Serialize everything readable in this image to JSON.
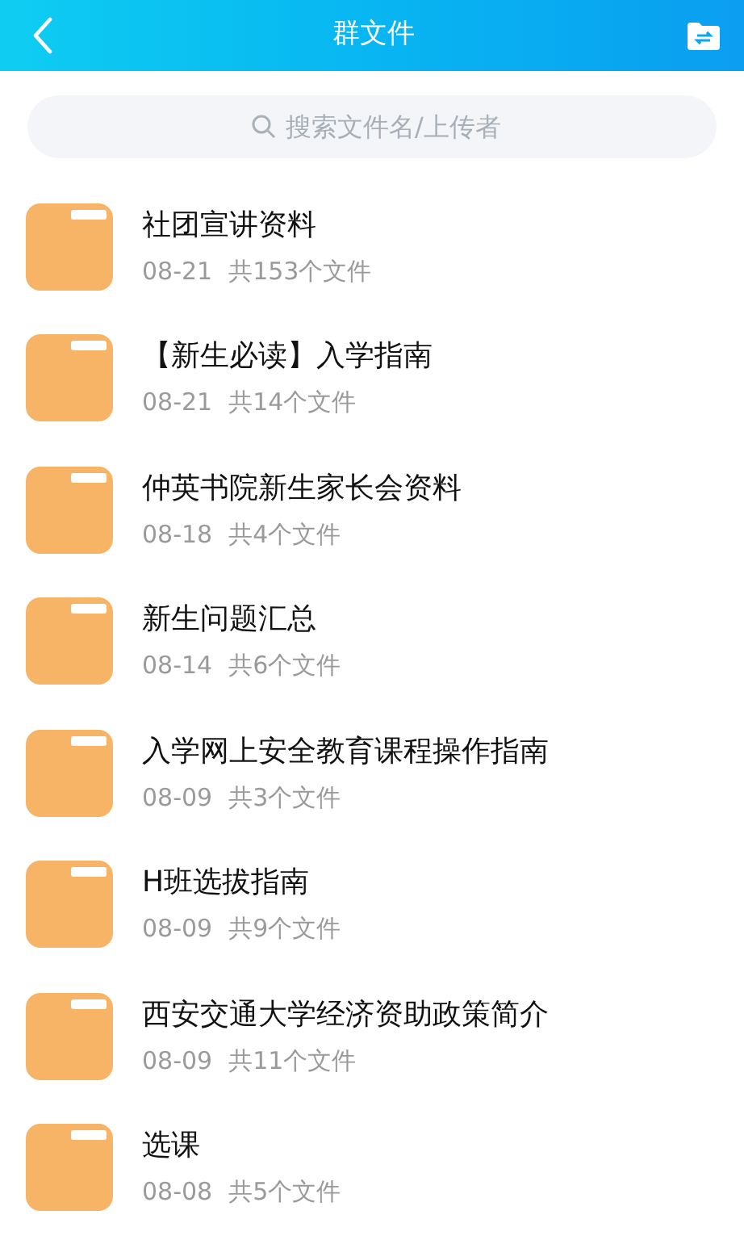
{
  "header": {
    "title": "群文件"
  },
  "search": {
    "placeholder": "搜索文件名/上传者"
  },
  "folders": [
    {
      "name": "社团宣讲资料",
      "date": "08-21",
      "count": "共153个文件"
    },
    {
      "name": "【新生必读】入学指南",
      "date": "08-21",
      "count": "共14个文件"
    },
    {
      "name": "仲英书院新生家长会资料",
      "date": "08-18",
      "count": "共4个文件"
    },
    {
      "name": "新生问题汇总",
      "date": "08-14",
      "count": "共6个文件"
    },
    {
      "name": "入学网上安全教育课程操作指南",
      "date": "08-09",
      "count": "共3个文件"
    },
    {
      "name": "H班选拔指南",
      "date": "08-09",
      "count": "共9个文件"
    },
    {
      "name": "西安交通大学经济资助政策简介",
      "date": "08-09",
      "count": "共11个文件"
    },
    {
      "name": "选课",
      "date": "08-08",
      "count": "共5个文件"
    }
  ]
}
